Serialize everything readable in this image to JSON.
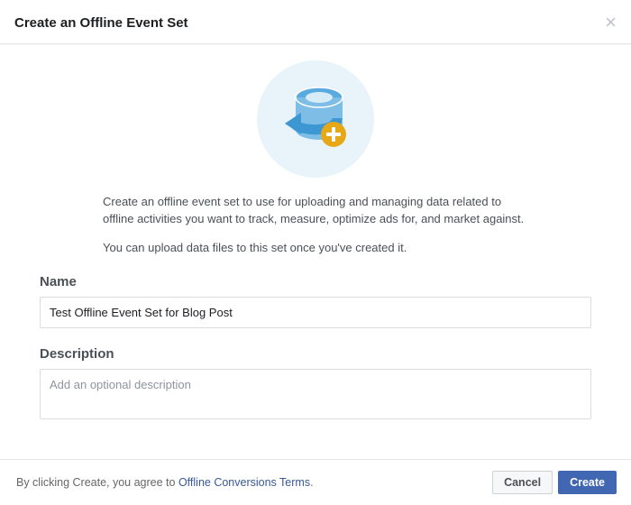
{
  "header": {
    "title": "Create an Offline Event Set"
  },
  "body": {
    "para1": "Create an offline event set to use for uploading and managing data related to offline activities you want to track, measure, optimize ads for, and market against.",
    "para2": "You can upload data files to this set once you've created it.",
    "name_label": "Name",
    "name_value": "Test Offline Event Set for Blog Post",
    "description_label": "Description",
    "description_placeholder": "Add an optional description"
  },
  "footer": {
    "terms_prefix": "By clicking Create, you agree to ",
    "terms_link": "Offline Conversions Terms",
    "terms_suffix": ".",
    "cancel_label": "Cancel",
    "create_label": "Create"
  },
  "icons": {
    "illustration": "database-add-icon",
    "close": "close-icon"
  },
  "colors": {
    "accent_blue": "#4267b2",
    "illus_bg": "#e8f4f9",
    "db_color": "#59aade",
    "arrow_color": "#3d97d3",
    "badge_color": "#e6a817"
  }
}
